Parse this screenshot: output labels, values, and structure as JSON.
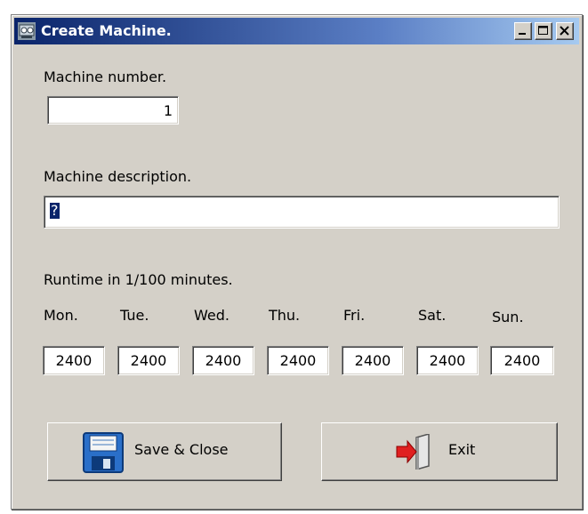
{
  "window": {
    "title": "Create Machine.",
    "controls": {
      "minimize": "minimize-icon",
      "maximize": "maximize-icon",
      "close": "close-icon"
    }
  },
  "machine_number": {
    "label": "Machine number.",
    "value": "1"
  },
  "machine_description": {
    "label": "Machine description.",
    "value": "?"
  },
  "runtime": {
    "label": "Runtime in 1/100 minutes.",
    "days": [
      {
        "label": "Mon.",
        "value": "2400"
      },
      {
        "label": "Tue.",
        "value": "2400"
      },
      {
        "label": "Wed.",
        "value": "2400"
      },
      {
        "label": "Thu.",
        "value": "2400"
      },
      {
        "label": "Fri.",
        "value": "2400"
      },
      {
        "label": "Sat.",
        "value": "2400"
      },
      {
        "label": "Sun.",
        "value": "2400"
      }
    ]
  },
  "buttons": {
    "save_label": "Save & Close",
    "save_icon": "floppy-disk-icon",
    "exit_label": "Exit",
    "exit_icon": "exit-door-icon"
  },
  "colors": {
    "title_bar_start": "#0a246a",
    "title_bar_end": "#a6caf0",
    "window_face": "#d4d0c8",
    "selection": "#0a246a",
    "exit_arrow": "#e02020"
  }
}
